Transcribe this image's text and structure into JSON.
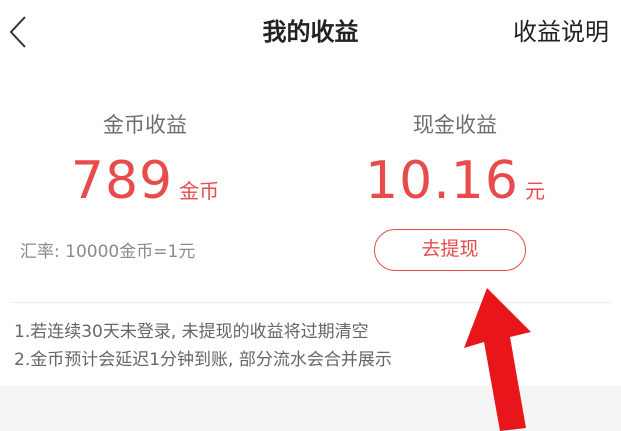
{
  "header": {
    "title": "我的收益",
    "action": "收益说明"
  },
  "coins": {
    "label": "金币收益",
    "value": "789",
    "unit": "金币"
  },
  "cash": {
    "label": "现金收益",
    "value": "10.16",
    "unit": "元"
  },
  "rate_text": "汇率: 10000金币=1元",
  "withdraw_label": "去提现",
  "notes": [
    "1.若连续30天未登录, 未提现的收益将过期清空",
    "2.金币预计会延迟1分钟到账, 部分流水会合并展示"
  ],
  "colors": {
    "accent": "#e84b4b",
    "annotation_arrow": "#e8161b"
  }
}
